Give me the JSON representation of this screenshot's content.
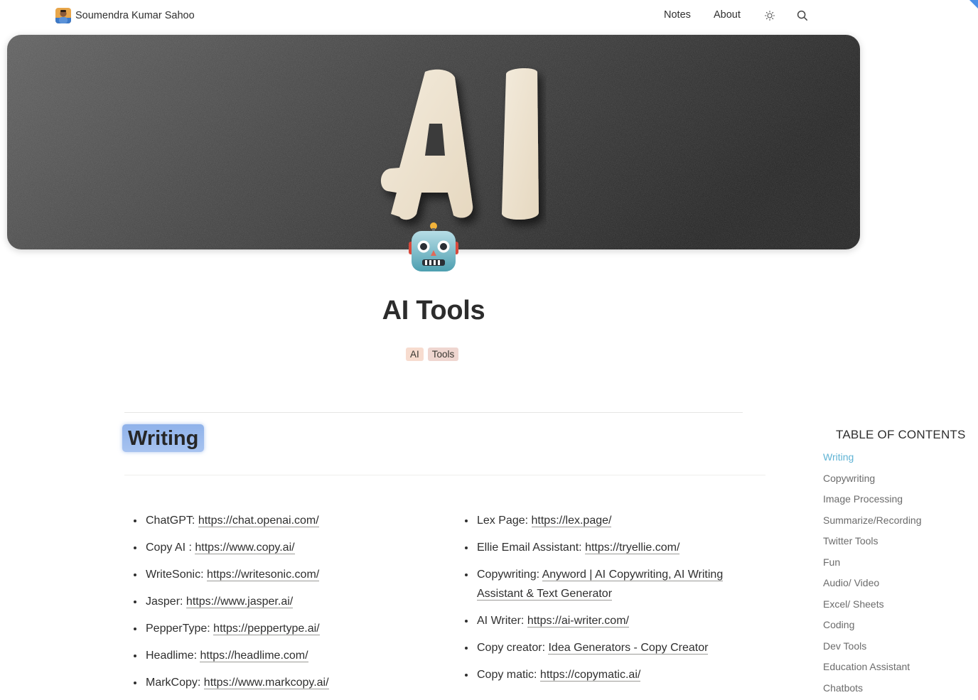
{
  "header": {
    "site_name": "Soumendra Kumar Sahoo",
    "nav": [
      {
        "label": "Notes"
      },
      {
        "label": "About"
      }
    ],
    "icons": [
      "sun-theme-toggle-icon",
      "search-icon"
    ]
  },
  "cover": {
    "text": "AI",
    "emoji": "robot-face-icon"
  },
  "page": {
    "title": "AI Tools",
    "tags": [
      "AI",
      "Tools"
    ]
  },
  "section": {
    "heading": "Writing"
  },
  "lists": {
    "left": [
      {
        "label": "ChatGPT: ",
        "link": "https://chat.openai.com/"
      },
      {
        "label": "Copy AI : ",
        "link": "https://www.copy.ai/"
      },
      {
        "label": "WriteSonic: ",
        "link": "https://writesonic.com/"
      },
      {
        "label": "Jasper: ",
        "link": "https://www.jasper.ai/"
      },
      {
        "label": "PepperType: ",
        "link": "https://peppertype.ai/"
      },
      {
        "label": "Headlime: ",
        "link": "https://headlime.com/"
      },
      {
        "label": "MarkCopy: ",
        "link": "https://www.markcopy.ai/"
      }
    ],
    "right": [
      {
        "label": "Lex Page: ",
        "link": "https://lex.page/"
      },
      {
        "label": "Ellie Email Assistant: ",
        "link": "https://tryellie.com/"
      },
      {
        "label": "Copywriting: ",
        "link": "Anyword | AI Copywriting, AI Writing Assistant & Text Generator"
      },
      {
        "label": "AI Writer: ",
        "link": "https://ai-writer.com/"
      },
      {
        "label": "Copy creator: ",
        "link": "Idea Generators - Copy Creator"
      },
      {
        "label": "Copy matic: ",
        "link": "https://copymatic.ai/"
      }
    ]
  },
  "toc": {
    "title": "TABLE OF CONTENTS",
    "items": [
      "Writing",
      "Copywriting",
      "Image Processing",
      "Summarize/Recording",
      "Twitter Tools",
      "Fun",
      "Audio/ Video",
      "Excel/ Sheets",
      "Coding",
      "Dev Tools",
      "Education Assistant",
      "Chatbots"
    ],
    "active": "Writing"
  },
  "colors": {
    "heading_highlight": "#8fb2ea",
    "toc_active": "#5fb3d4",
    "tag_ai": "#f7dccf",
    "tag_tools": "#efd6d0"
  }
}
